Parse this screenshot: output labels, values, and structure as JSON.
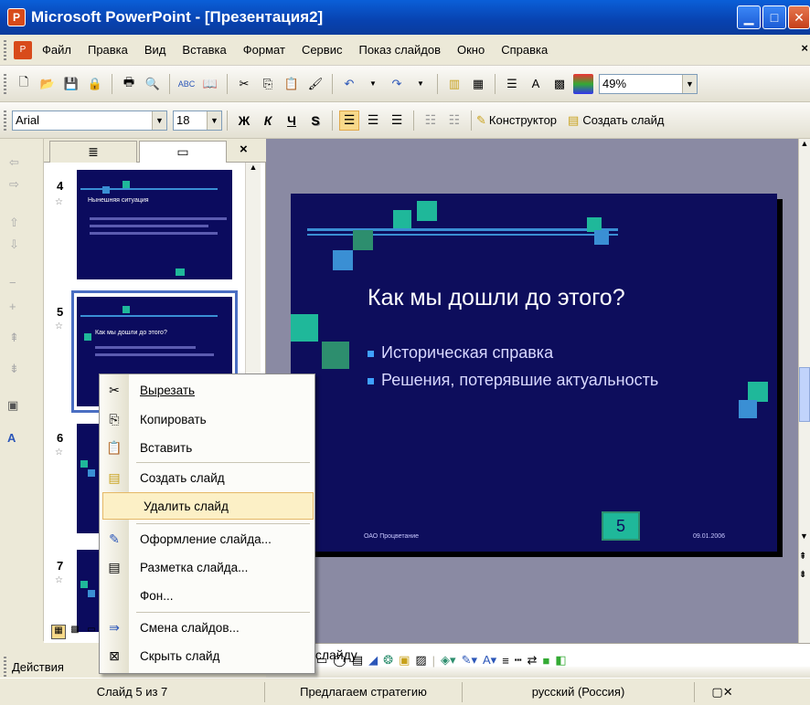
{
  "window": {
    "title": "Microsoft PowerPoint - [Презентация2]",
    "controls": [
      "minimize",
      "maximize",
      "close"
    ]
  },
  "menubar": {
    "items": [
      "Файл",
      "Правка",
      "Вид",
      "Вставка",
      "Формат",
      "Сервис",
      "Показ слайдов",
      "Окно",
      "Справка"
    ],
    "close_glyph": "×"
  },
  "standard_toolbar": {
    "zoom": "49%"
  },
  "formatting_toolbar": {
    "font": "Arial",
    "size": "18",
    "bold": "Ж",
    "italic": "К",
    "underline": "Ч",
    "shadow": "S",
    "designer_label": "Конструктор",
    "new_slide_label": "Создать слайд"
  },
  "slides_pane": {
    "close_glyph": "×",
    "thumbnails": [
      {
        "number": "4",
        "title": "Нынешняя ситуация"
      },
      {
        "number": "5",
        "title": "Как мы дошли до этого?"
      },
      {
        "number": "6",
        "title": ""
      },
      {
        "number": "7",
        "title": ""
      }
    ]
  },
  "slide": {
    "title": "Как мы дошли до этого?",
    "bullets": [
      "Историческая справка",
      "Решения, потерявшие актуальность"
    ],
    "footer_left": "ОАО Процветание",
    "footer_date": "09.01.2006",
    "slide_number": "5",
    "colors": {
      "background": "#0d0d5c",
      "accent": "#1fb89a",
      "accent2": "#3a8fd4"
    }
  },
  "context_menu": {
    "items": [
      {
        "label": "Вырезать",
        "icon": "scissors-icon"
      },
      {
        "label": "Копировать",
        "icon": "copy-icon"
      },
      {
        "label": "Вставить",
        "icon": "paste-icon"
      },
      {
        "label": "Создать слайд",
        "icon": "new-slide-icon"
      },
      {
        "label": "Удалить слайд",
        "icon": "",
        "highlighted": true
      },
      {
        "label": "Оформление слайда...",
        "icon": "slide-design-icon"
      },
      {
        "label": "Разметка слайда...",
        "icon": "slide-layout-icon"
      },
      {
        "label": "Фон...",
        "icon": ""
      },
      {
        "label": "Смена слайдов...",
        "icon": "slide-transition-icon"
      },
      {
        "label": "Скрыть слайд",
        "icon": "hide-slide-icon"
      }
    ]
  },
  "notes": {
    "placeholder": "ки к слайду"
  },
  "drawing_toolbar": {
    "actions_label": "Действия"
  },
  "statusbar": {
    "slide_info": "Слайд 5 из 7",
    "design": "Предлагаем стратегию",
    "language": "русский (Россия)"
  }
}
